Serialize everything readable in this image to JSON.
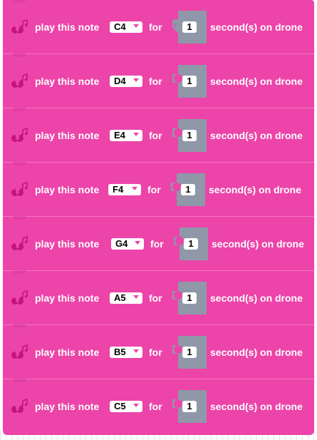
{
  "colors": {
    "block_fill": "#ec44a9",
    "puzzle_fill": "#8f97a9",
    "icon_fill": "#c2167f",
    "caret": "#ec44a9"
  },
  "icons": {
    "block_icon": "drone-music-icon",
    "dropdown_caret": "dropdown-caret-icon"
  },
  "blocks": [
    {
      "play_label": "play this note",
      "note": "C4",
      "for_label": "for",
      "duration": "1",
      "suffix": "second(s) on drone"
    },
    {
      "play_label": "play this note",
      "note": "D4",
      "for_label": "for",
      "duration": "1",
      "suffix": "second(s) on drone"
    },
    {
      "play_label": "play this note",
      "note": "E4",
      "for_label": "for",
      "duration": "1",
      "suffix": "second(s) on drone"
    },
    {
      "play_label": "play this note",
      "note": "F4",
      "for_label": "for",
      "duration": "1",
      "suffix": "second(s) on drone"
    },
    {
      "play_label": "play this note",
      "note": "G4",
      "for_label": "for",
      "duration": "1",
      "suffix": "second(s) on drone"
    },
    {
      "play_label": "play this note",
      "note": "A5",
      "for_label": "for",
      "duration": "1",
      "suffix": "second(s) on drone"
    },
    {
      "play_label": "play this note",
      "note": "B5",
      "for_label": "for",
      "duration": "1",
      "suffix": "second(s) on drone"
    },
    {
      "play_label": "play this note",
      "note": "C5",
      "for_label": "for",
      "duration": "1",
      "suffix": "second(s) on drone"
    }
  ]
}
